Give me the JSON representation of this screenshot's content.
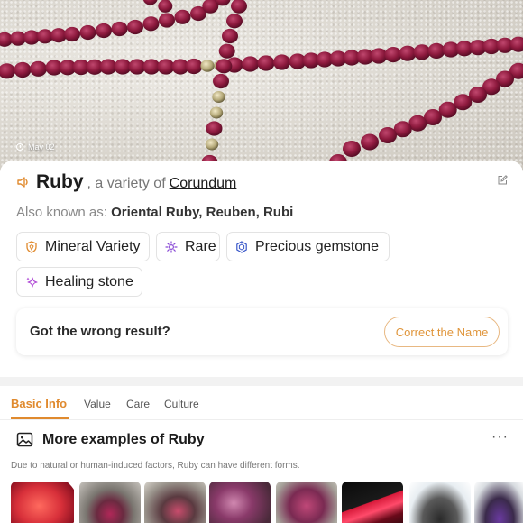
{
  "hero": {
    "date": "May 02"
  },
  "title": {
    "name": "Ruby",
    "variety_prefix": ", a variety of",
    "parent_mineral": "Corundum"
  },
  "aka": {
    "label": "Also known as:",
    "names": "Oriental Ruby, Reuben, Rubi"
  },
  "tags": [
    {
      "label": "Mineral Variety",
      "icon": "shield-icon",
      "color": "#e08a2e"
    },
    {
      "label": "Rare",
      "icon": "sparkle-sun-icon",
      "color": "#8a4bd6"
    },
    {
      "label": "Precious gemstone",
      "icon": "gem-hexagon-icon",
      "color": "#3a58c9"
    },
    {
      "label": "Healing stone",
      "icon": "sparkles-icon",
      "color": "#b04bd6"
    }
  ],
  "feedback": {
    "question": "Got the wrong result?",
    "button": "Correct the Name"
  },
  "tabs": [
    {
      "label": "Basic Info",
      "active": true
    },
    {
      "label": "Value",
      "active": false
    },
    {
      "label": "Care",
      "active": false
    },
    {
      "label": "Culture",
      "active": false
    }
  ],
  "examples": {
    "title": "More examples of Ruby",
    "description": "Due to natural or human-induced factors, Ruby can have different forms.",
    "more_icon": "more-dots-icon"
  },
  "colors": {
    "accent": "#e08a2e",
    "ruby": "#8e1a3e"
  }
}
